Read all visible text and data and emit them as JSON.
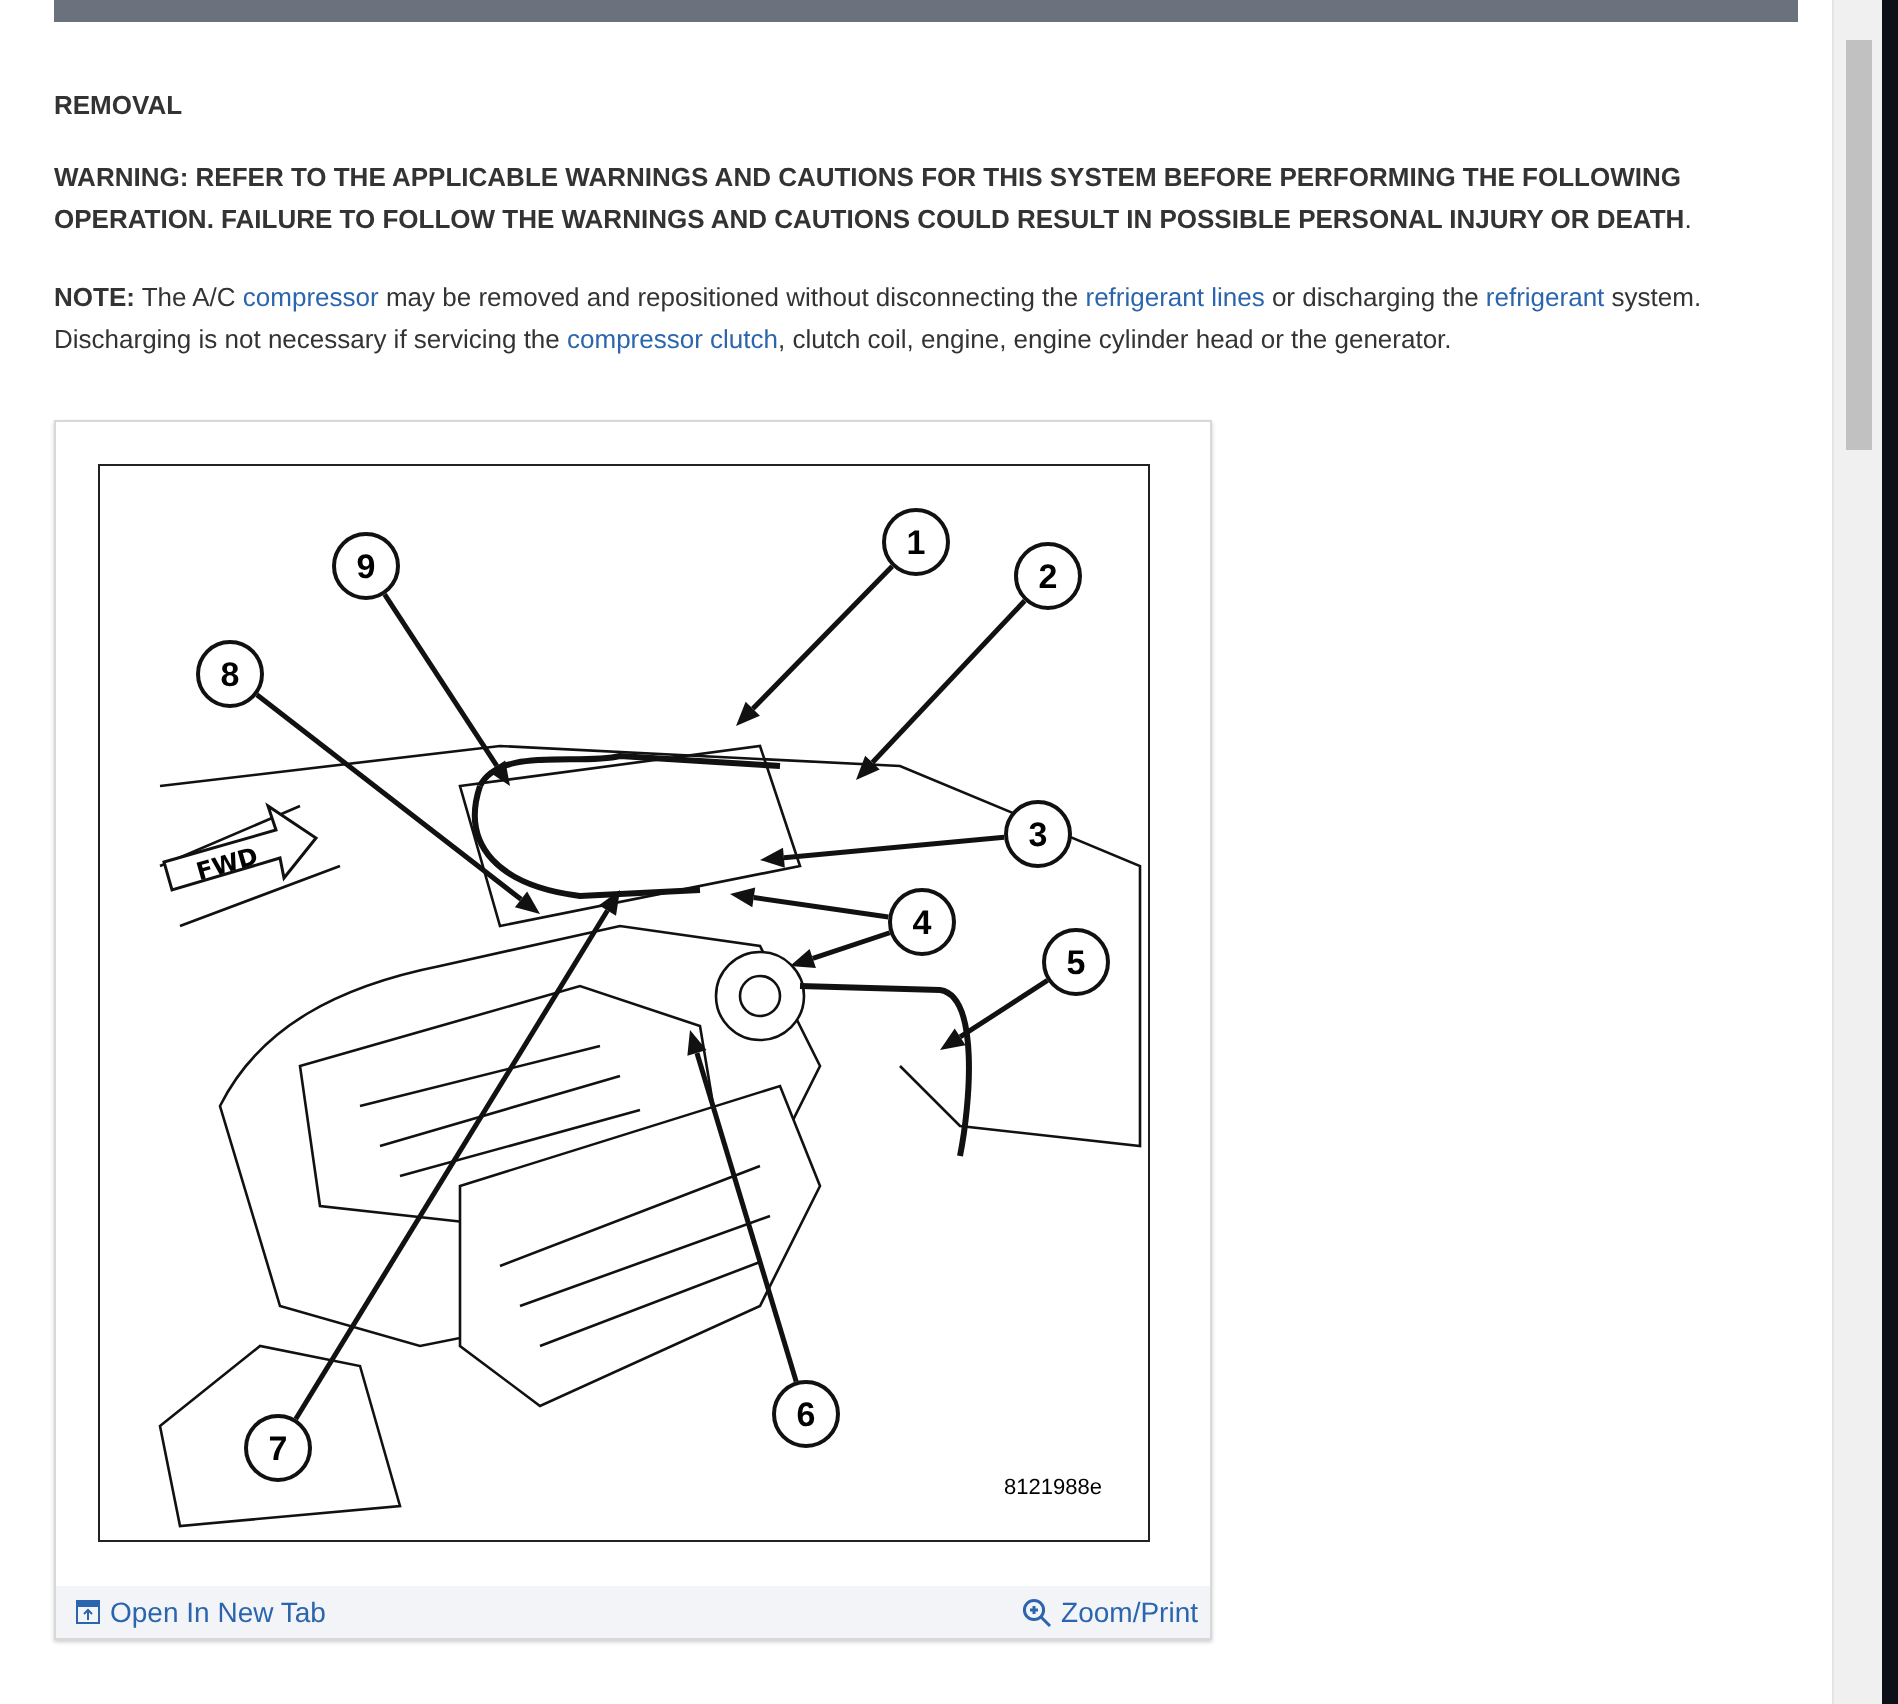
{
  "heading": "REMOVAL",
  "warning": "**WARNING: REFER TO THE APPLICABLE WARNINGS AND CAUTIONS FOR THIS SYSTEM BEFORE PERFORMING THE FOLLOWING OPERATION. FAILURE TO FOLLOW THE WARNINGS AND CAUTIONS COULD RESULT IN POSSIBLE PERSONAL INJURY OR DEATH**.",
  "note": [
    {
      "kind": "text",
      "text": "**NOTE:** The A/C "
    },
    {
      "kind": "link",
      "text": "compressor"
    },
    {
      "kind": "text",
      "text": " may be removed and repositioned without disconnecting the "
    },
    {
      "kind": "link",
      "text": "refrigerant lines"
    },
    {
      "kind": "text",
      "text": " or discharging the "
    },
    {
      "kind": "link",
      "text": "refrigerant"
    },
    {
      "kind": "text",
      "text": " system. Discharging is not necessary if servicing the "
    },
    {
      "kind": "link",
      "text": "compressor clutch"
    },
    {
      "kind": "text",
      "text": ", clutch coil, engine, engine cylinder head or the generator."
    }
  ],
  "figure": {
    "direction_label": "FWD",
    "callouts": [
      "1",
      "2",
      "3",
      "4",
      "5",
      "6",
      "7",
      "8",
      "9"
    ],
    "figure_id": "8121988e",
    "footer": {
      "open_link": "Open In New Tab",
      "zoom_link": "Zoom/Print"
    }
  }
}
